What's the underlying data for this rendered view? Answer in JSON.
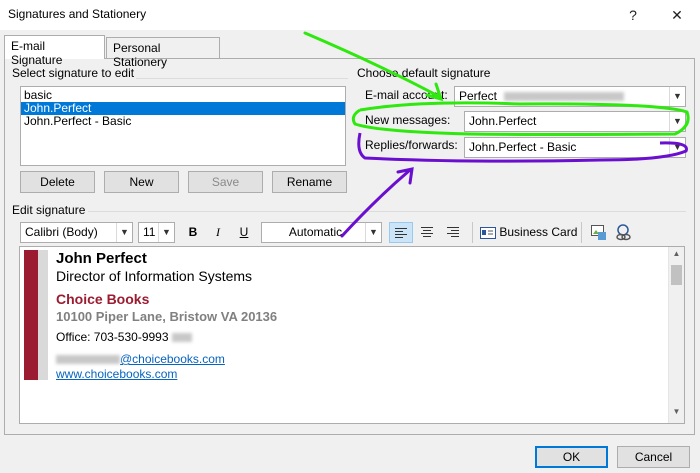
{
  "window": {
    "title": "Signatures and Stationery",
    "help_glyph": "?",
    "close_glyph": "✕"
  },
  "tabs": [
    {
      "label": "E-mail Signature"
    },
    {
      "label": "Personal Stationery"
    }
  ],
  "select_group": {
    "label": "Select signature to edit"
  },
  "signatures": [
    "basic",
    "John.Perfect",
    "John.Perfect - Basic"
  ],
  "selected_signature": "John.Perfect",
  "sig_buttons": {
    "delete": "Delete",
    "new": "New",
    "save": "Save",
    "rename": "Rename"
  },
  "default_group": {
    "label": "Choose default signature",
    "account_label": "E-mail account:",
    "account_value": "Perfect",
    "new_messages_label": "New messages:",
    "new_messages_value": "John.Perfect",
    "replies_label": "Replies/forwards:",
    "replies_value": "John.Perfect - Basic"
  },
  "edit_group": {
    "label": "Edit signature"
  },
  "toolbar": {
    "font": "Calibri (Body)",
    "size": "11",
    "bold": "B",
    "italic": "I",
    "underline": "U",
    "color": "Automatic",
    "business_card": "Business Card"
  },
  "signature_content": {
    "name": "John Perfect",
    "title": "Director of Information Systems",
    "company": "Choice Books",
    "address": "10100 Piper Lane, Bristow VA 20136",
    "office": "Office: 703-530-9993",
    "email_domain": "@choicebooks.com",
    "website": "www.choicebooks.com"
  },
  "colors": {
    "brand_red": "#9b1c31",
    "selection": "#0078d7",
    "link": "#0563c1",
    "annotation_green": "#2ee80e",
    "annotation_purple": "#6a0fcf"
  },
  "footer": {
    "ok": "OK",
    "cancel": "Cancel"
  }
}
